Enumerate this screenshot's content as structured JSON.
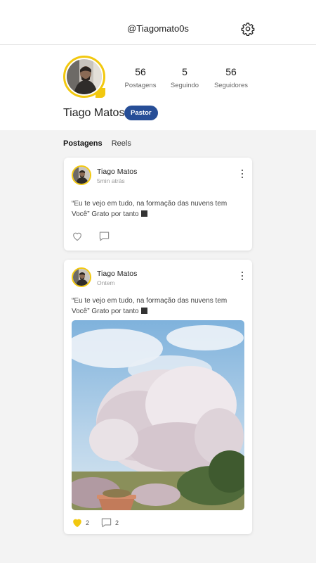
{
  "header": {
    "handle": "@Tiagomato0s",
    "settings_icon": "gear-icon"
  },
  "profile": {
    "name": "Tiago Matos",
    "badge": "Pastor",
    "ring_color": "#f2c80f",
    "badge_color": "#274e97",
    "stats": [
      {
        "value": "56",
        "label": "Postagens"
      },
      {
        "value": "5",
        "label": "Seguindo"
      },
      {
        "value": "56",
        "label": "Seguidores"
      }
    ]
  },
  "tabs": [
    {
      "label": "Postagens",
      "active": true
    },
    {
      "label": "Reels",
      "active": false
    }
  ],
  "posts": [
    {
      "author": "Tiago Matos",
      "time": "5min atrás",
      "text": "“Eu te vejo em tudo, na formação das nuvens tem Você” Grato por tanto",
      "liked": false,
      "likes": "",
      "comments": "",
      "has_image": false
    },
    {
      "author": "Tiago Matos",
      "time": "Ontem",
      "text": "“Eu te vejo em tudo, na formação das nuvens tem Você” Grato por tanto",
      "liked": true,
      "likes": "2",
      "comments": "2",
      "has_image": true
    }
  ]
}
